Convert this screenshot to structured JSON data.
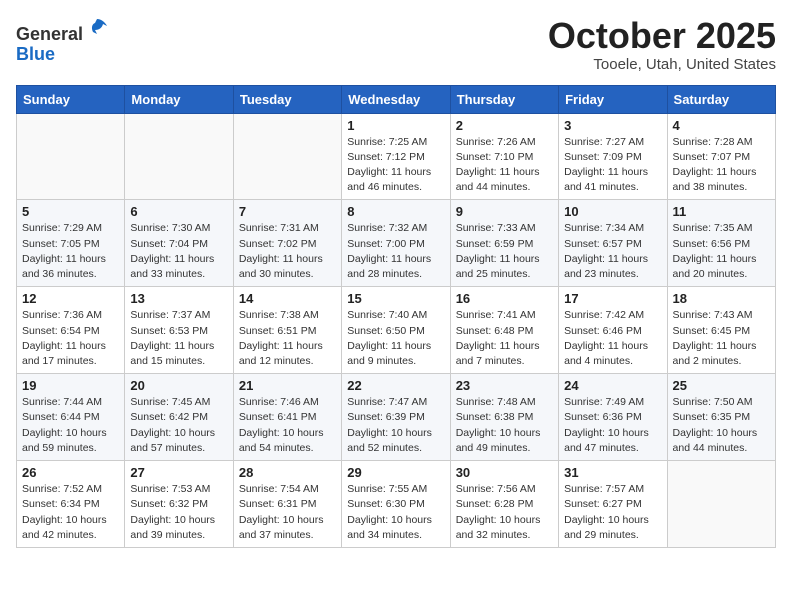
{
  "header": {
    "logo_line1": "General",
    "logo_line2": "Blue",
    "month": "October 2025",
    "location": "Tooele, Utah, United States"
  },
  "weekdays": [
    "Sunday",
    "Monday",
    "Tuesday",
    "Wednesday",
    "Thursday",
    "Friday",
    "Saturday"
  ],
  "weeks": [
    [
      {
        "day": "",
        "info": ""
      },
      {
        "day": "",
        "info": ""
      },
      {
        "day": "",
        "info": ""
      },
      {
        "day": "1",
        "info": "Sunrise: 7:25 AM\nSunset: 7:12 PM\nDaylight: 11 hours\nand 46 minutes."
      },
      {
        "day": "2",
        "info": "Sunrise: 7:26 AM\nSunset: 7:10 PM\nDaylight: 11 hours\nand 44 minutes."
      },
      {
        "day": "3",
        "info": "Sunrise: 7:27 AM\nSunset: 7:09 PM\nDaylight: 11 hours\nand 41 minutes."
      },
      {
        "day": "4",
        "info": "Sunrise: 7:28 AM\nSunset: 7:07 PM\nDaylight: 11 hours\nand 38 minutes."
      }
    ],
    [
      {
        "day": "5",
        "info": "Sunrise: 7:29 AM\nSunset: 7:05 PM\nDaylight: 11 hours\nand 36 minutes."
      },
      {
        "day": "6",
        "info": "Sunrise: 7:30 AM\nSunset: 7:04 PM\nDaylight: 11 hours\nand 33 minutes."
      },
      {
        "day": "7",
        "info": "Sunrise: 7:31 AM\nSunset: 7:02 PM\nDaylight: 11 hours\nand 30 minutes."
      },
      {
        "day": "8",
        "info": "Sunrise: 7:32 AM\nSunset: 7:00 PM\nDaylight: 11 hours\nand 28 minutes."
      },
      {
        "day": "9",
        "info": "Sunrise: 7:33 AM\nSunset: 6:59 PM\nDaylight: 11 hours\nand 25 minutes."
      },
      {
        "day": "10",
        "info": "Sunrise: 7:34 AM\nSunset: 6:57 PM\nDaylight: 11 hours\nand 23 minutes."
      },
      {
        "day": "11",
        "info": "Sunrise: 7:35 AM\nSunset: 6:56 PM\nDaylight: 11 hours\nand 20 minutes."
      }
    ],
    [
      {
        "day": "12",
        "info": "Sunrise: 7:36 AM\nSunset: 6:54 PM\nDaylight: 11 hours\nand 17 minutes."
      },
      {
        "day": "13",
        "info": "Sunrise: 7:37 AM\nSunset: 6:53 PM\nDaylight: 11 hours\nand 15 minutes."
      },
      {
        "day": "14",
        "info": "Sunrise: 7:38 AM\nSunset: 6:51 PM\nDaylight: 11 hours\nand 12 minutes."
      },
      {
        "day": "15",
        "info": "Sunrise: 7:40 AM\nSunset: 6:50 PM\nDaylight: 11 hours\nand 9 minutes."
      },
      {
        "day": "16",
        "info": "Sunrise: 7:41 AM\nSunset: 6:48 PM\nDaylight: 11 hours\nand 7 minutes."
      },
      {
        "day": "17",
        "info": "Sunrise: 7:42 AM\nSunset: 6:46 PM\nDaylight: 11 hours\nand 4 minutes."
      },
      {
        "day": "18",
        "info": "Sunrise: 7:43 AM\nSunset: 6:45 PM\nDaylight: 11 hours\nand 2 minutes."
      }
    ],
    [
      {
        "day": "19",
        "info": "Sunrise: 7:44 AM\nSunset: 6:44 PM\nDaylight: 10 hours\nand 59 minutes."
      },
      {
        "day": "20",
        "info": "Sunrise: 7:45 AM\nSunset: 6:42 PM\nDaylight: 10 hours\nand 57 minutes."
      },
      {
        "day": "21",
        "info": "Sunrise: 7:46 AM\nSunset: 6:41 PM\nDaylight: 10 hours\nand 54 minutes."
      },
      {
        "day": "22",
        "info": "Sunrise: 7:47 AM\nSunset: 6:39 PM\nDaylight: 10 hours\nand 52 minutes."
      },
      {
        "day": "23",
        "info": "Sunrise: 7:48 AM\nSunset: 6:38 PM\nDaylight: 10 hours\nand 49 minutes."
      },
      {
        "day": "24",
        "info": "Sunrise: 7:49 AM\nSunset: 6:36 PM\nDaylight: 10 hours\nand 47 minutes."
      },
      {
        "day": "25",
        "info": "Sunrise: 7:50 AM\nSunset: 6:35 PM\nDaylight: 10 hours\nand 44 minutes."
      }
    ],
    [
      {
        "day": "26",
        "info": "Sunrise: 7:52 AM\nSunset: 6:34 PM\nDaylight: 10 hours\nand 42 minutes."
      },
      {
        "day": "27",
        "info": "Sunrise: 7:53 AM\nSunset: 6:32 PM\nDaylight: 10 hours\nand 39 minutes."
      },
      {
        "day": "28",
        "info": "Sunrise: 7:54 AM\nSunset: 6:31 PM\nDaylight: 10 hours\nand 37 minutes."
      },
      {
        "day": "29",
        "info": "Sunrise: 7:55 AM\nSunset: 6:30 PM\nDaylight: 10 hours\nand 34 minutes."
      },
      {
        "day": "30",
        "info": "Sunrise: 7:56 AM\nSunset: 6:28 PM\nDaylight: 10 hours\nand 32 minutes."
      },
      {
        "day": "31",
        "info": "Sunrise: 7:57 AM\nSunset: 6:27 PM\nDaylight: 10 hours\nand 29 minutes."
      },
      {
        "day": "",
        "info": ""
      }
    ]
  ]
}
